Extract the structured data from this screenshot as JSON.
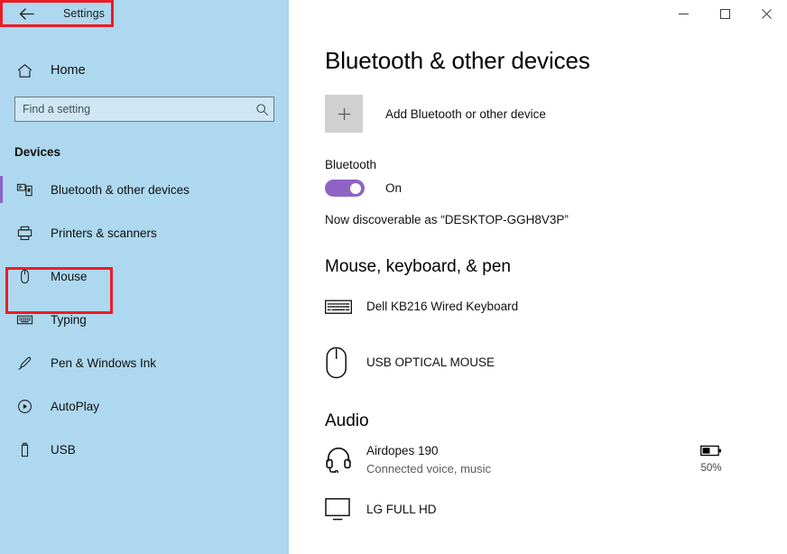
{
  "window": {
    "app_title": "Settings",
    "back_icon": "back-arrow-icon",
    "watermark": "",
    "controls": {
      "minimize": "─",
      "maximize": "☐",
      "close": "✕"
    }
  },
  "sidebar": {
    "home": {
      "label": "Home",
      "icon": "home-icon"
    },
    "search": {
      "value": "",
      "placeholder": "Find a setting",
      "icon": "search-icon"
    },
    "section_title": "Devices",
    "items": [
      {
        "label": "Bluetooth & other devices",
        "icon": "bluetooth-devices-icon",
        "selected": true
      },
      {
        "label": "Printers & scanners",
        "icon": "printer-icon",
        "selected": false
      },
      {
        "label": "Mouse",
        "icon": "mouse-icon",
        "selected": false
      },
      {
        "label": "Typing",
        "icon": "keyboard-icon",
        "selected": false
      },
      {
        "label": "Pen & Windows Ink",
        "icon": "pen-icon",
        "selected": false
      },
      {
        "label": "AutoPlay",
        "icon": "autoplay-icon",
        "selected": false
      },
      {
        "label": "USB",
        "icon": "usb-icon",
        "selected": false
      }
    ]
  },
  "main": {
    "page_title": "Bluetooth & other devices",
    "add_device": {
      "label": "Add Bluetooth or other device",
      "icon": "plus-icon"
    },
    "bluetooth": {
      "label": "Bluetooth",
      "state": "On",
      "toggle_on": true,
      "discoverable_text": "Now discoverable as “DESKTOP-GGH8V3P”"
    },
    "groups": [
      {
        "heading": "Mouse, keyboard, & pen",
        "devices": [
          {
            "name": "Dell KB216 Wired Keyboard",
            "sub": "",
            "icon": "keyboard-icon",
            "battery": ""
          },
          {
            "name": "USB OPTICAL MOUSE",
            "sub": "",
            "icon": "mouse-icon",
            "battery": ""
          }
        ]
      },
      {
        "heading": "Audio",
        "devices": [
          {
            "name": "Airdopes 190",
            "sub": "Connected voice, music",
            "icon": "headset-icon",
            "battery": "50%"
          },
          {
            "name": "LG FULL HD",
            "sub": "",
            "icon": "monitor-icon",
            "battery": ""
          }
        ]
      }
    ]
  },
  "annotations": {
    "color": "#ED1C24",
    "boxes": [
      {
        "name": "settings-title-highlight"
      },
      {
        "name": "mouse-nav-highlight"
      }
    ]
  }
}
